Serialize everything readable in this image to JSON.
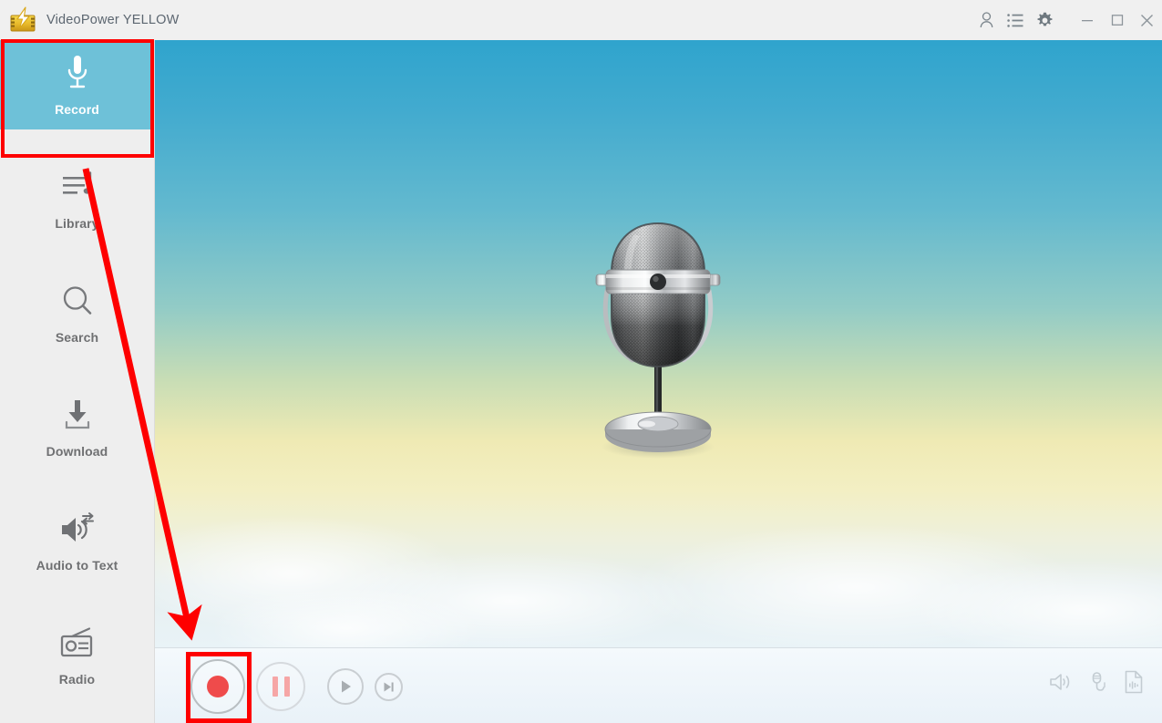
{
  "window": {
    "title": "VideoPower YELLOW",
    "logo_icon": "videopower-logo-icon",
    "titlebar_icons": [
      {
        "name": "account-icon",
        "label": "Account"
      },
      {
        "name": "task-list-icon",
        "label": "Task List"
      },
      {
        "name": "gear-icon",
        "label": "Settings"
      }
    ],
    "controls": [
      {
        "name": "minimize-button",
        "label": "Minimize"
      },
      {
        "name": "maximize-button",
        "label": "Maximize"
      },
      {
        "name": "close-button",
        "label": "Close"
      }
    ]
  },
  "sidebar": {
    "active_index": 0,
    "active_bg": "#6ec1d8",
    "items": [
      {
        "label": "Record",
        "icon": "microphone-icon"
      },
      {
        "label": "Library",
        "icon": "music-library-icon"
      },
      {
        "label": "Search",
        "icon": "search-icon"
      },
      {
        "label": "Download",
        "icon": "download-icon"
      },
      {
        "label": "Audio to Text",
        "icon": "audio-to-text-icon"
      },
      {
        "label": "Radio",
        "icon": "radio-icon"
      }
    ]
  },
  "stage": {
    "artwork": "vintage-microphone-illustration",
    "background": "sky-gradient-blue-to-yellow-clouds",
    "gradient_top": "#2fa4cd",
    "gradient_mid": "#efeab4",
    "gradient_bottom": "#e9f3f7"
  },
  "controls": {
    "record": {
      "label": "Record",
      "icon": "record-dot-icon",
      "accent": "#ef4b4b"
    },
    "pause": {
      "label": "Pause",
      "icon": "pause-icon",
      "accent": "#f6a6a6"
    },
    "play": {
      "label": "Play",
      "icon": "play-icon"
    },
    "next": {
      "label": "Next",
      "icon": "skip-next-icon"
    },
    "right_icons": [
      {
        "label": "System Sound",
        "icon": "speaker-volume-icon"
      },
      {
        "label": "Microphone",
        "icon": "microphone-plug-icon"
      },
      {
        "label": "Output Format",
        "icon": "audio-file-icon"
      }
    ]
  },
  "annotations": {
    "color": "#fe0000",
    "highlight_boxes": [
      {
        "name": "record-tab-highlight",
        "target": "Record"
      },
      {
        "name": "record-button-highlight",
        "target": "Record button"
      }
    ],
    "arrow": {
      "name": "guide-arrow",
      "from": "Record tab",
      "to": "Record button"
    }
  }
}
